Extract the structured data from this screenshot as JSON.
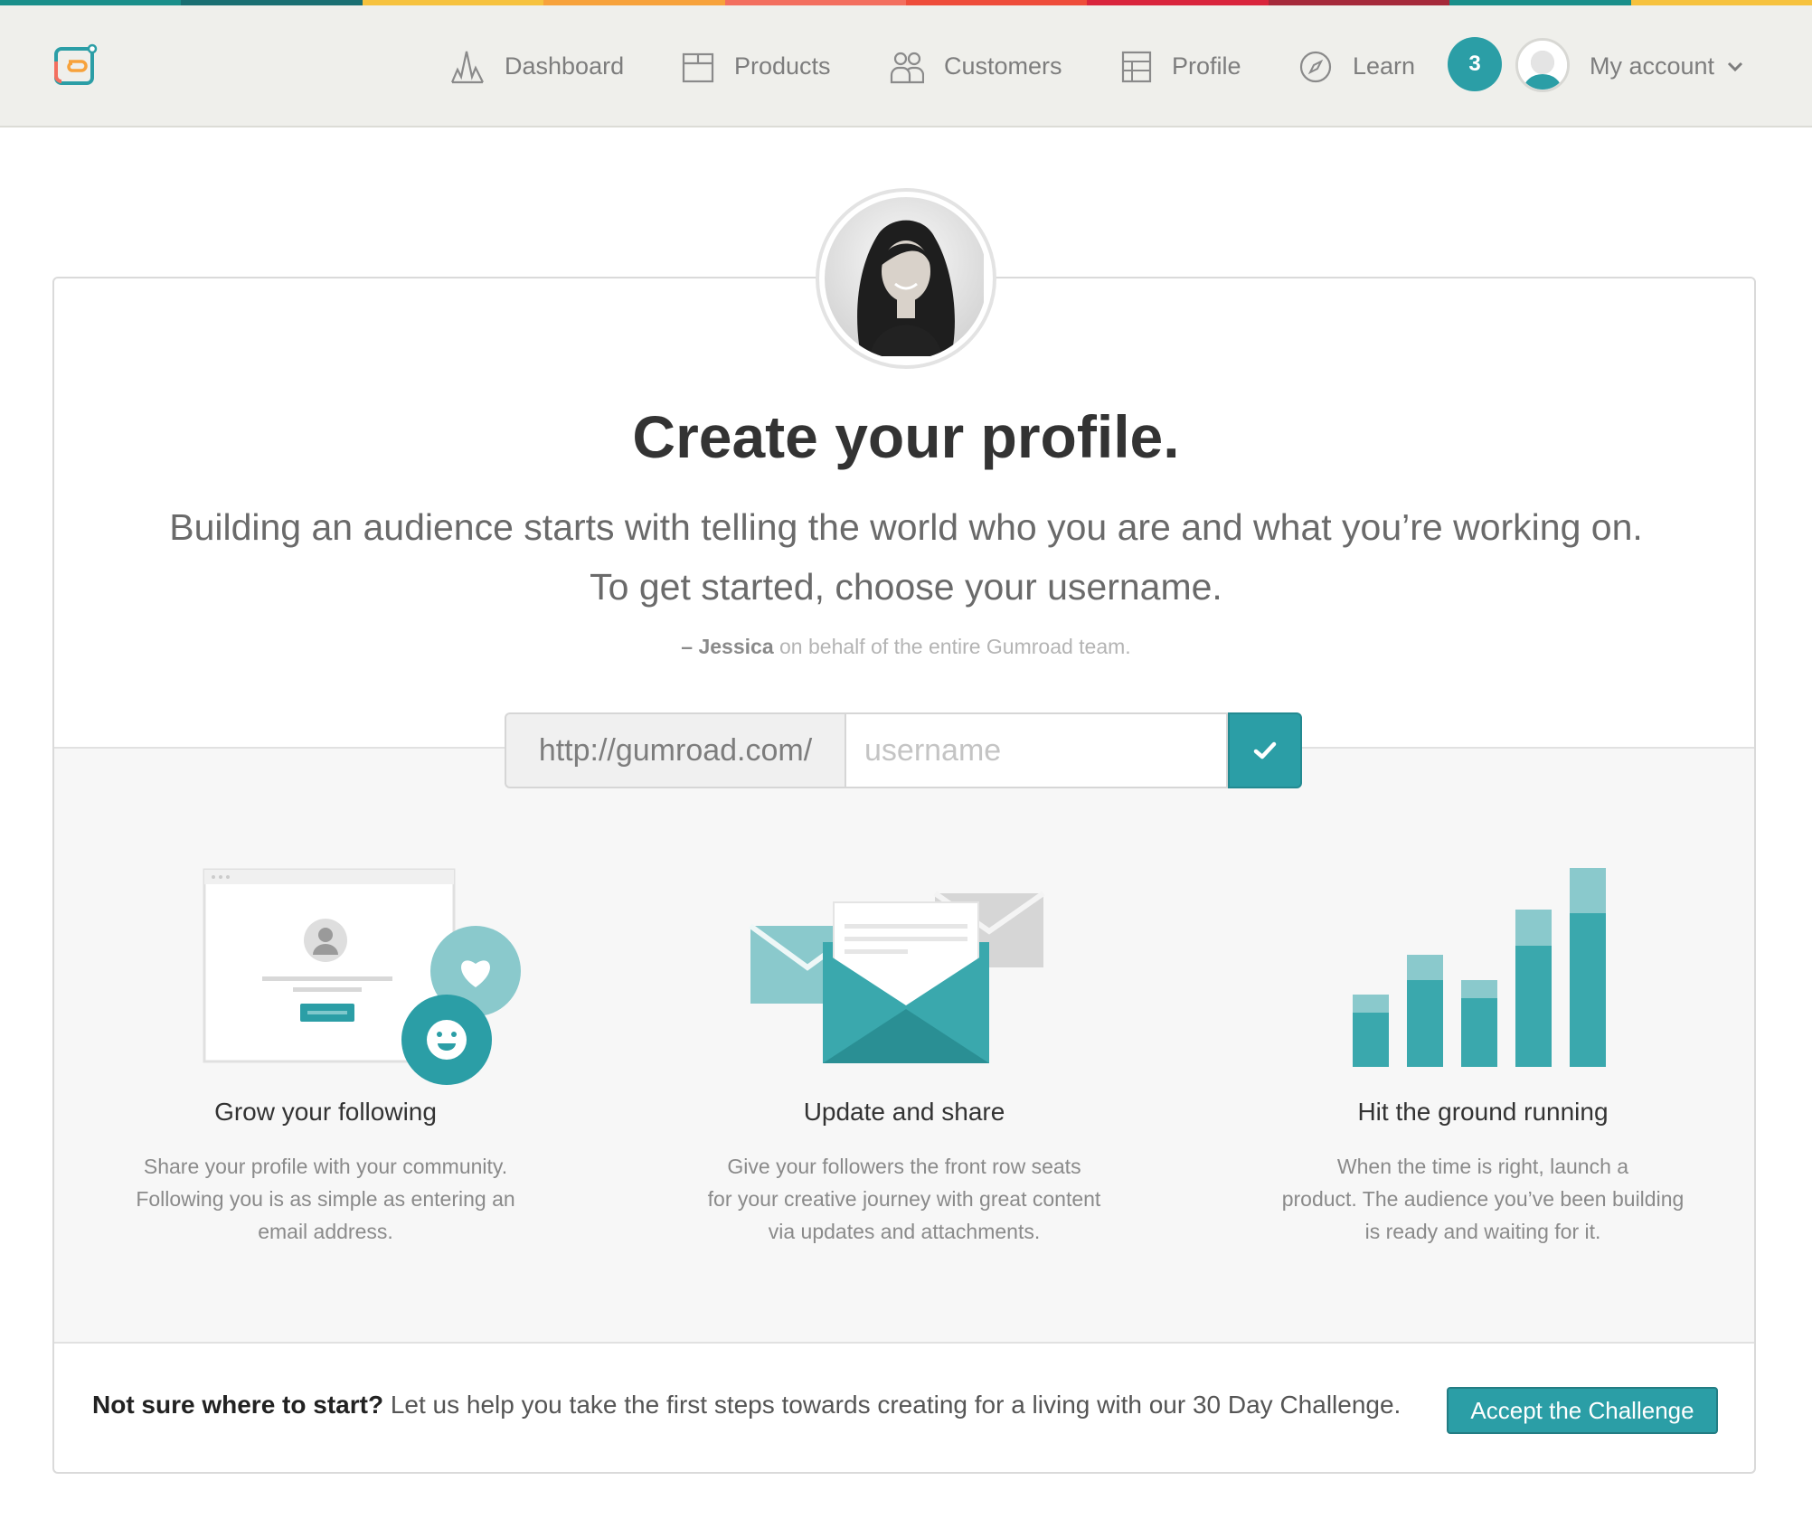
{
  "stripe_colors": [
    "#1a8f8a",
    "#1a6f72",
    "#f6c23e",
    "#f7a23b",
    "#f36f5f",
    "#ee4d3a",
    "#d9253c",
    "#a52a3a",
    "#1a8f8a",
    "#f6c23e"
  ],
  "brand": {
    "accent": "#2b9ea6",
    "logo_icon": "gumroad-logo-icon"
  },
  "nav": {
    "items": [
      {
        "label": "Dashboard",
        "icon": "dashboard-icon"
      },
      {
        "label": "Products",
        "icon": "products-icon"
      },
      {
        "label": "Customers",
        "icon": "customers-icon"
      },
      {
        "label": "Profile",
        "icon": "profile-icon"
      },
      {
        "label": "Learn",
        "icon": "compass-icon"
      }
    ],
    "notification_count": "3",
    "account_label": "My account"
  },
  "hero": {
    "title": "Create your profile.",
    "lead_line1": "Building an audience starts with telling the world who you are and what you’re working on.",
    "lead_line2": "To get started, choose your username.",
    "signature_name": "– Jessica",
    "signature_rest": " on behalf of the entire Gumroad team."
  },
  "url_form": {
    "prefix": "http://gumroad.com/",
    "placeholder": "username",
    "value": ""
  },
  "features": [
    {
      "title": "Grow your following",
      "desc_lines": [
        "Share your profile with your community.",
        "Following you is as simple as entering an",
        "email address."
      ]
    },
    {
      "title": "Update and share",
      "desc_lines": [
        "Give your followers the front row seats",
        "for your creative journey with great content",
        "via updates and attachments."
      ]
    },
    {
      "title": "Hit the ground running",
      "desc_lines": [
        "When the time is right, launch a",
        "product. The audience you’ve been building",
        "is ready and waiting for it."
      ]
    }
  ],
  "cta": {
    "bold": "Not sure where to start?",
    "text": " Let us help you take the first steps towards creating for a living with our 30 Day Challenge.",
    "button": "Accept the Challenge"
  }
}
